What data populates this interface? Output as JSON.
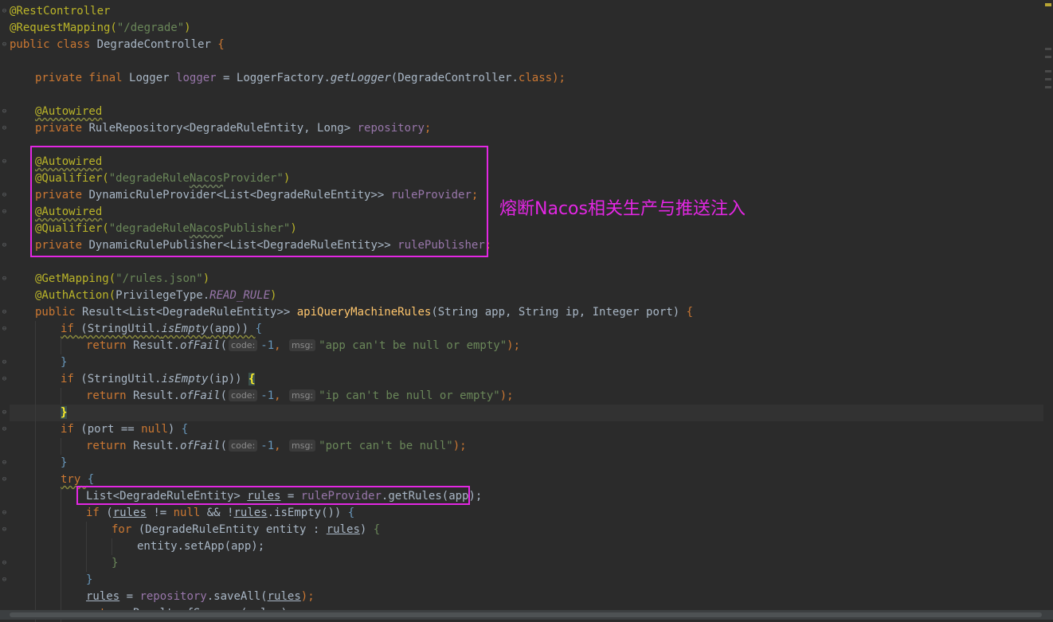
{
  "editor": {
    "annotation_note": "熔断Nacos相关生产与推送注入",
    "hint_code": "code:",
    "hint_msg": "msg:"
  },
  "code": {
    "l1": "@RestController",
    "l2a": "@RequestMapping(",
    "l2b": "\"/degrade\"",
    "l2c": ")",
    "l3a": "public class ",
    "l3b": "DegradeController ",
    "l3c": "{",
    "l5a": "private final ",
    "l5b": "Logger ",
    "l5c": "logger",
    "l5d": " = LoggerFactory.",
    "l5e": "getLogger",
    "l5f": "(DegradeController.",
    "l5g": "class",
    "l5h": ");",
    "autowired": "@Autowired",
    "l8a": "private ",
    "l8b": "RuleRepository<DegradeRuleEntity, Long> ",
    "l8c": "repository",
    "l8d": ";",
    "qualifier": "@Qualifier(",
    "q1a": "\"degradeRule",
    "q1b": "Nacos",
    "q1c": "Provider\"",
    "close_paren": ")",
    "l12a": "private ",
    "l12b": "DynamicRuleProvider<List<DegradeRuleEntity>> ",
    "l12c": "ruleProvider",
    "l12d": ";",
    "q2a": "\"degradeRule",
    "q2b": "Nacos",
    "q2c": "Publisher\"",
    "l15a": "private ",
    "l15b": "DynamicRulePublisher<List<DegradeRuleEntity>> ",
    "l15c": "rulePublisher",
    "l15d": ";",
    "l17a": "@GetMapping(",
    "l17b": "\"/rules.json\"",
    "l17c": ")",
    "l18a": "@AuthAction(",
    "l18b": "PrivilegeType.",
    "l18c": "READ_RULE",
    "l18d": ")",
    "l19a": "public ",
    "l19b": "Result<List<DegradeRuleEntity>> ",
    "l19c": "apiQueryMachineRules",
    "l19d": "(String app, String ip, Integer port) ",
    "l19e": "{",
    "l20a": "if ",
    "l20b": "(StringUtil.",
    "l20c": "isEmpty",
    "l20d": "(app)) ",
    "l20e": "{",
    "return_kw": "return ",
    "result_dot": "Result.",
    "offail": "ofFail",
    "open_paren": "(",
    "minus_one": "-1",
    "comma": ", ",
    "l21s": "\"app can't be null or empty\"",
    "stmt_end": ");",
    "close_brace": "}",
    "l23a": "if ",
    "l23b": "(StringUtil.",
    "l23c": "isEmpty",
    "l23d": "(ip)) ",
    "l23e": "{",
    "l24s": "\"ip can't be null or empty\"",
    "l26a": "if ",
    "l26b": "(port == ",
    "l26c": "null",
    "l26d": ") ",
    "l26e": "{",
    "l27s": "\"port can't be null\"",
    "l29a": "try ",
    "l29b": "{",
    "l30a": "List<DegradeRuleEntity> ",
    "l30b": "rules",
    "l30c": " = ",
    "l30d": "ruleProvider",
    "l30e": ".getRules(app);",
    "l31a": "if ",
    "l31b": "(",
    "l31c": "rules",
    "l31d": " != ",
    "l31e": "null",
    "l31f": " && !",
    "l31g": "rules",
    "l31h": ".isEmpty()) ",
    "l31i": "{",
    "l32a": "for ",
    "l32b": "(DegradeRuleEntity entity : ",
    "l32c": "rules",
    "l32d": ") ",
    "l32e": "{",
    "l33": "entity.setApp(app);",
    "l36a": "rules",
    "l36b": " = ",
    "l36c": "repository",
    "l36d": ".saveAll(",
    "l36e": "rules",
    "l36f": ");",
    "l37a": "return ",
    "l37b": "Result.ofSuccess(rules);"
  }
}
